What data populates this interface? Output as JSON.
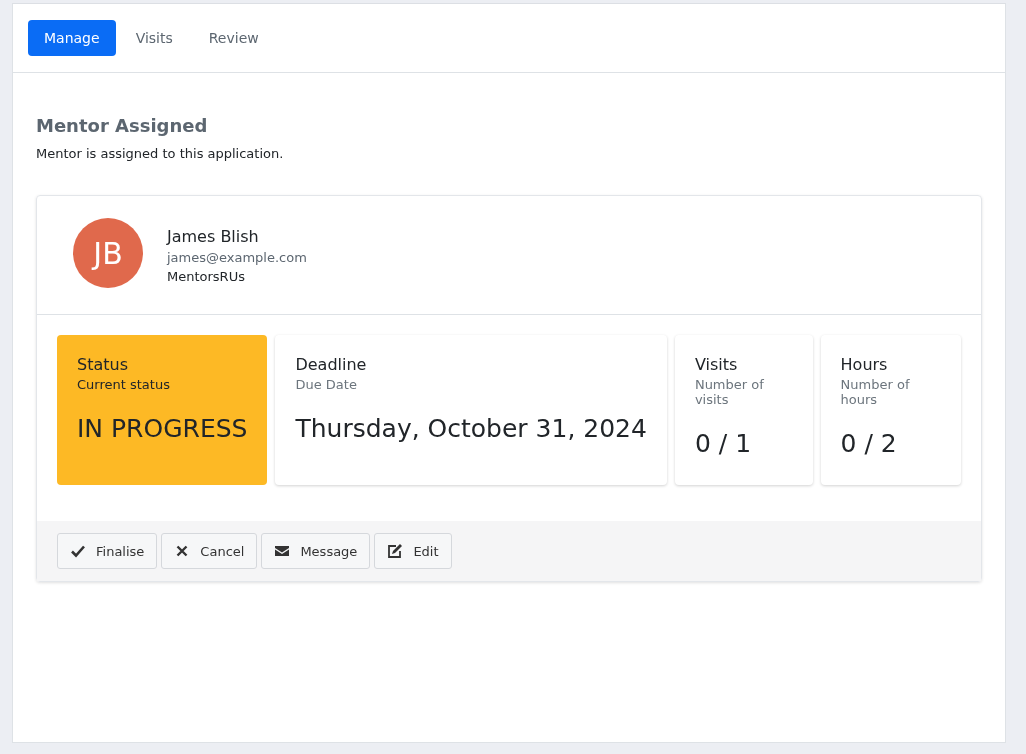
{
  "tabs": [
    {
      "label": "Manage",
      "selected": true
    },
    {
      "label": "Visits",
      "selected": false
    },
    {
      "label": "Review",
      "selected": false
    }
  ],
  "section": {
    "title": "Mentor Assigned",
    "description": "Mentor is assigned to this application."
  },
  "mentor": {
    "initials": "JB",
    "name": "James Blish",
    "email": "james@example.com",
    "organisation": "MentorsRUs"
  },
  "stats": [
    {
      "title": "Status",
      "subtitle": "Current status",
      "value": "IN PROGRESS",
      "highlighted": true
    },
    {
      "title": "Deadline",
      "subtitle": "Due Date",
      "value": "Thursday, October 31, 2024",
      "highlighted": false
    },
    {
      "title": "Visits",
      "subtitle": "Number of visits",
      "value": "0 / 1",
      "highlighted": false
    },
    {
      "title": "Hours",
      "subtitle": "Number of hours",
      "value": "0 / 2",
      "highlighted": false
    }
  ],
  "actions": [
    "Finalise",
    "Cancel",
    "Message",
    "Edit"
  ]
}
